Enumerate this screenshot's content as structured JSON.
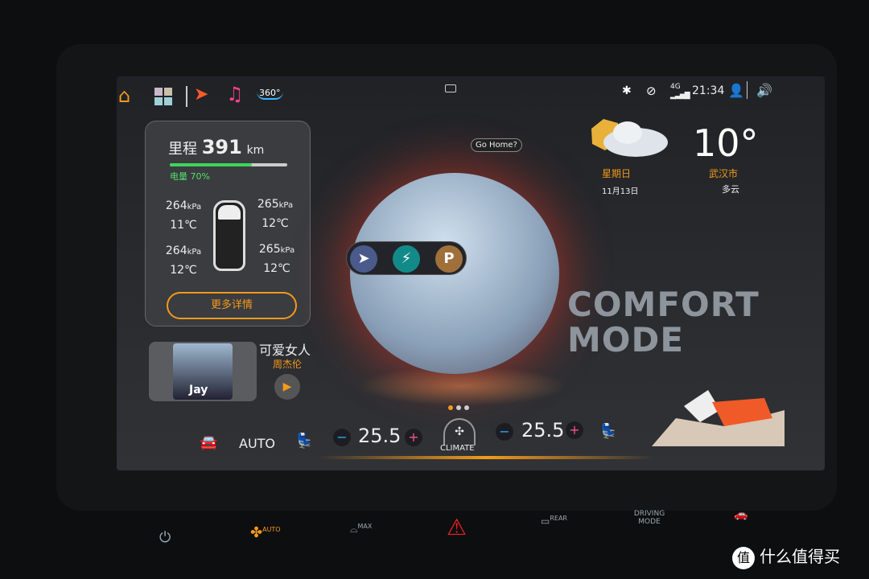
{
  "status_bar": {
    "time": "21:34",
    "network": "4G",
    "icons": [
      "bluetooth-icon",
      "wifi-off-icon",
      "signal-icon",
      "user-icon",
      "volume-icon"
    ]
  },
  "top_nav": {
    "icons": [
      "home-icon",
      "apps-icon",
      "navigation-icon",
      "music-icon",
      "360-camera-icon"
    ],
    "camera_label": "360°"
  },
  "vehicle_card": {
    "range_label": "里程",
    "range_value": "391",
    "range_unit": "km",
    "battery_label": "电量 70%",
    "battery_percent": 70,
    "tires": [
      {
        "pressure": "264",
        "unit": "kPa",
        "temp": "11℃"
      },
      {
        "pressure": "265",
        "unit": "kPa",
        "temp": "12℃"
      },
      {
        "pressure": "264",
        "unit": "kPa",
        "temp": "12℃"
      },
      {
        "pressure": "265",
        "unit": "kPa",
        "temp": "12℃"
      }
    ],
    "more_button": "更多详情"
  },
  "music": {
    "title": "可爱女人",
    "artist": "周杰伦",
    "album_text": "Jay"
  },
  "map_widget": {
    "prompt": "Go Home?",
    "poi_buttons": [
      "navigate-icon",
      "charging-icon",
      "P"
    ]
  },
  "mode": {
    "line1": "COMFORT",
    "line2": "MODE"
  },
  "weather": {
    "weekday": "星期日",
    "date": "11月13日",
    "temperature": "10°",
    "city": "武汉市",
    "condition": "多云"
  },
  "pager": {
    "count": 3,
    "active": 0
  },
  "climate": {
    "mode": "AUTO",
    "left_temp": "25.5",
    "right_temp": "25.5",
    "center_label": "CLIMATE",
    "minus": "−",
    "plus": "+"
  },
  "hardware_buttons": {
    "fan_auto": "AUTO",
    "defrost_max": "MAX",
    "rear": "REAR",
    "driving_mode": "DRIVING MODE"
  },
  "watermark": "什么值得买",
  "colors": {
    "accent": "#f49a1a",
    "battery": "#3fd45a",
    "plus": "#ff4f8a",
    "minus": "#2fa8ff"
  }
}
